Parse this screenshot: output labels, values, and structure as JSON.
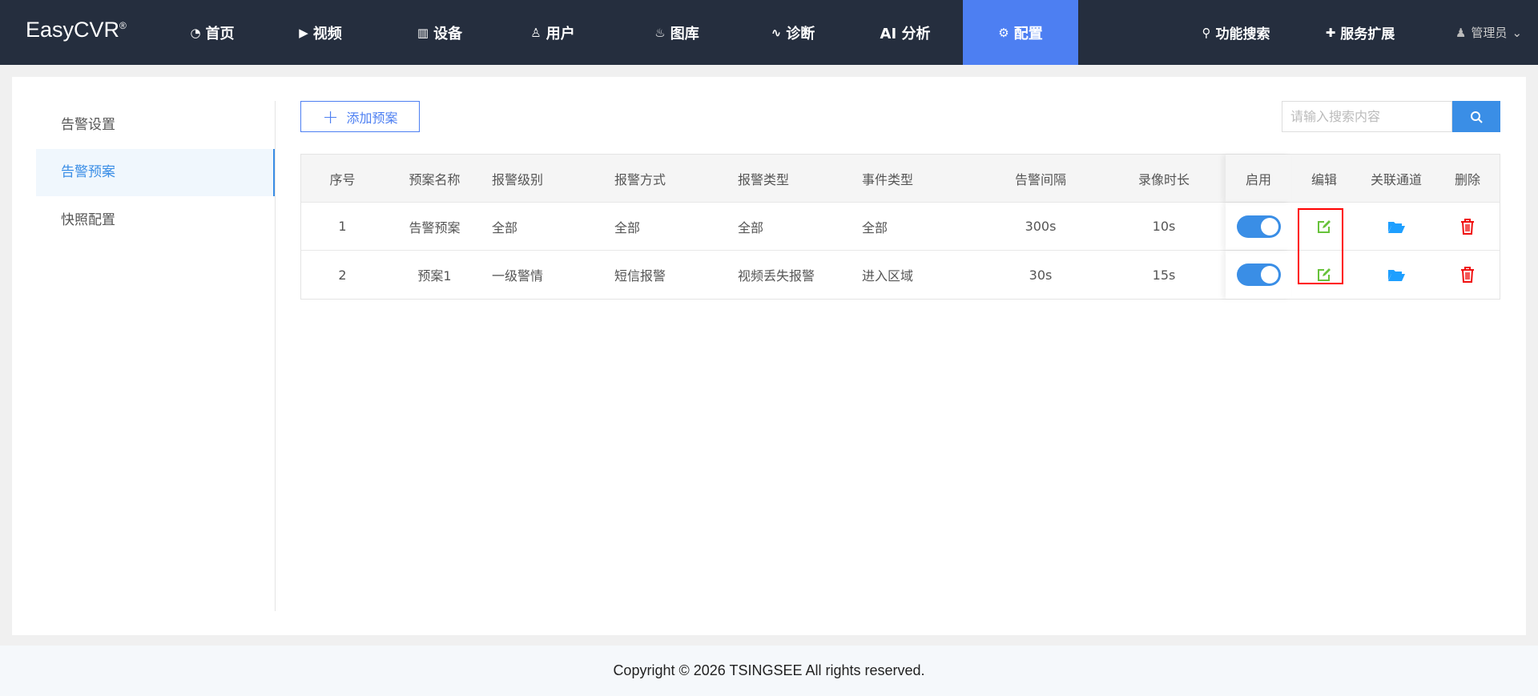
{
  "app": {
    "logo": "EasyCVR",
    "reg": "®"
  },
  "nav": [
    {
      "label": "首页",
      "icon": "dashboard-icon"
    },
    {
      "label": "视频",
      "icon": "play-icon"
    },
    {
      "label": "设备",
      "icon": "device-icon"
    },
    {
      "label": "用户",
      "icon": "user-icon"
    },
    {
      "label": "图库",
      "icon": "alarm-icon"
    },
    {
      "label": "诊断",
      "icon": "pulse-icon"
    },
    {
      "label": "AI 分析",
      "icon": ""
    },
    {
      "label": "配置",
      "icon": "gear-icon"
    }
  ],
  "header_right": {
    "search": "功能搜索",
    "extend": "服务扩展",
    "user": "管理员"
  },
  "sidebar": [
    {
      "label": "告警设置"
    },
    {
      "label": "告警预案"
    },
    {
      "label": "快照配置"
    }
  ],
  "toolbar": {
    "add": "添加预案",
    "search_placeholder": "请输入搜索内容"
  },
  "table": {
    "headers": [
      "序号",
      "预案名称",
      "报警级别",
      "报警方式",
      "报警类型",
      "事件类型",
      "告警间隔",
      "录像时长",
      "启用",
      "编辑",
      "关联通道",
      "删除"
    ],
    "rows": [
      {
        "no": "1",
        "name": "告警预案",
        "level": "全部",
        "method": "全部",
        "type": "全部",
        "event": "全部",
        "interval": "300s",
        "duration": "10s",
        "enabled": true
      },
      {
        "no": "2",
        "name": "预案1",
        "level": "一级警情",
        "method": "短信报警",
        "type": "视频丢失报警",
        "event": "进入区域",
        "interval": "30s",
        "duration": "15s",
        "enabled": true
      }
    ]
  },
  "footer": "Copyright © 2026 TSINGSEE All rights reserved.",
  "colors": {
    "header": "#252e3e",
    "accent": "#4d7ff2",
    "blue": "#3a8ee6",
    "edit": "#67c23a",
    "delete": "#f01010"
  }
}
